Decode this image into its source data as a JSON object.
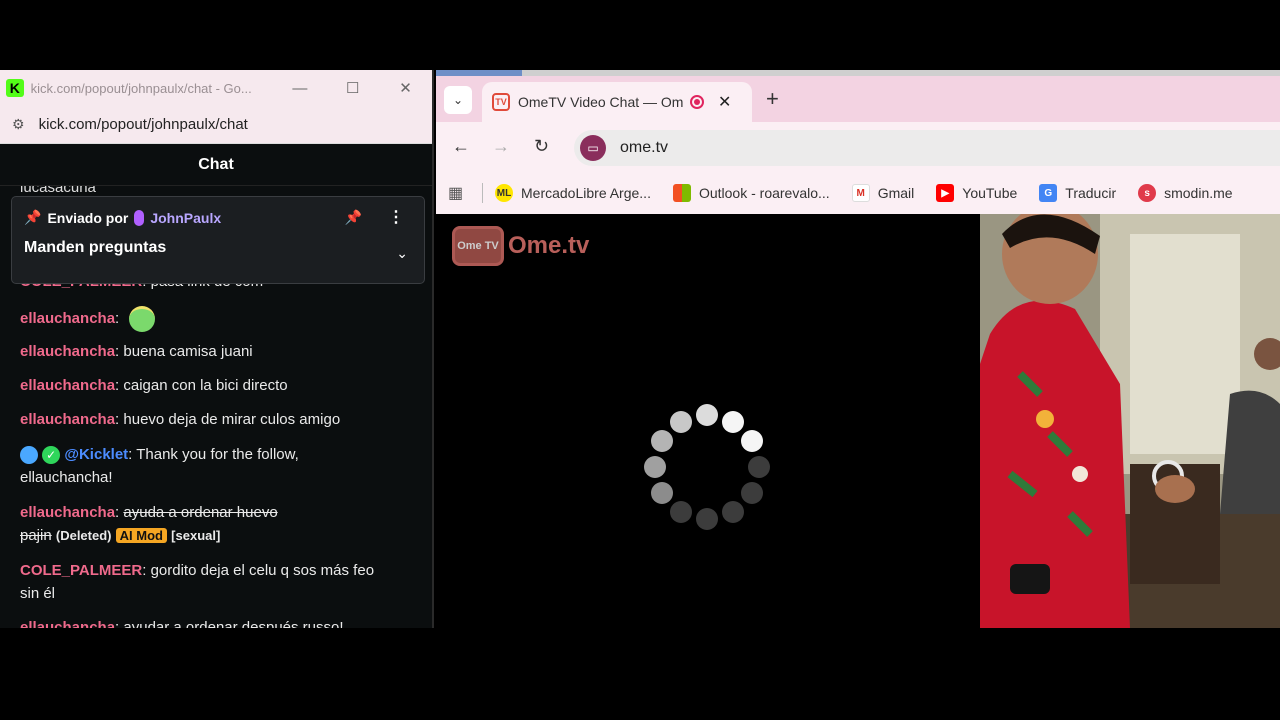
{
  "kick": {
    "title": "kick.com/popout/johnpaulx/chat - Go...",
    "url": "kick.com/popout/johnpaulx/chat",
    "logo": "K",
    "chat_header": "Chat",
    "pinned": {
      "label": "Enviado por",
      "user": "JohnPaulx",
      "message": "Manden preguntas"
    },
    "messages": [
      {
        "user": "lucasacuna",
        "text": ""
      },
      {
        "user": "COLE_PALMEER",
        "text": "pasa link de com"
      },
      {
        "user": "ellauchancha",
        "text": ":"
      },
      {
        "user": "ellauchancha",
        "text": ": buena camisa juani"
      },
      {
        "user": "ellauchancha",
        "text": ": caigan con la bici directo"
      },
      {
        "user": "ellauchancha",
        "text": ": huevo deja de mirar culos amigo"
      },
      {
        "user": "@Kicklet",
        "text": ": Thank you for the follow,",
        "text2": "ellauchancha!"
      },
      {
        "user": "ellauchancha",
        "text": ": ",
        "struck": "ayuda a ordenar huevo",
        "struck2": "pajin",
        "deleted": "(Deleted)",
        "badge": "AI Mod",
        "tag": "[sexual]"
      },
      {
        "user": "COLE_PALMEER",
        "text": ": gordito deja el celu q sos más feo",
        "text2": "sin él"
      },
      {
        "user": "ellauchancha",
        "text": ": ayudar a ordenar después russo!"
      }
    ]
  },
  "chrome": {
    "tab_title": "OmeTV Video Chat — Ome",
    "url": "ome.tv",
    "bookmarks": [
      "MercadoLibre Arge...",
      "Outlook - roarevalo...",
      "Gmail",
      "YouTube",
      "Traducir",
      "smodin.me"
    ],
    "logo_badge": "Ome TV",
    "logo_name": "Ome.tv"
  },
  "colors": {
    "kick_green": "#53fc18",
    "username_pink": "#f06a8c",
    "bot_blue": "#4c8cff",
    "chrome_tab_pink": "#f3d3e2"
  }
}
